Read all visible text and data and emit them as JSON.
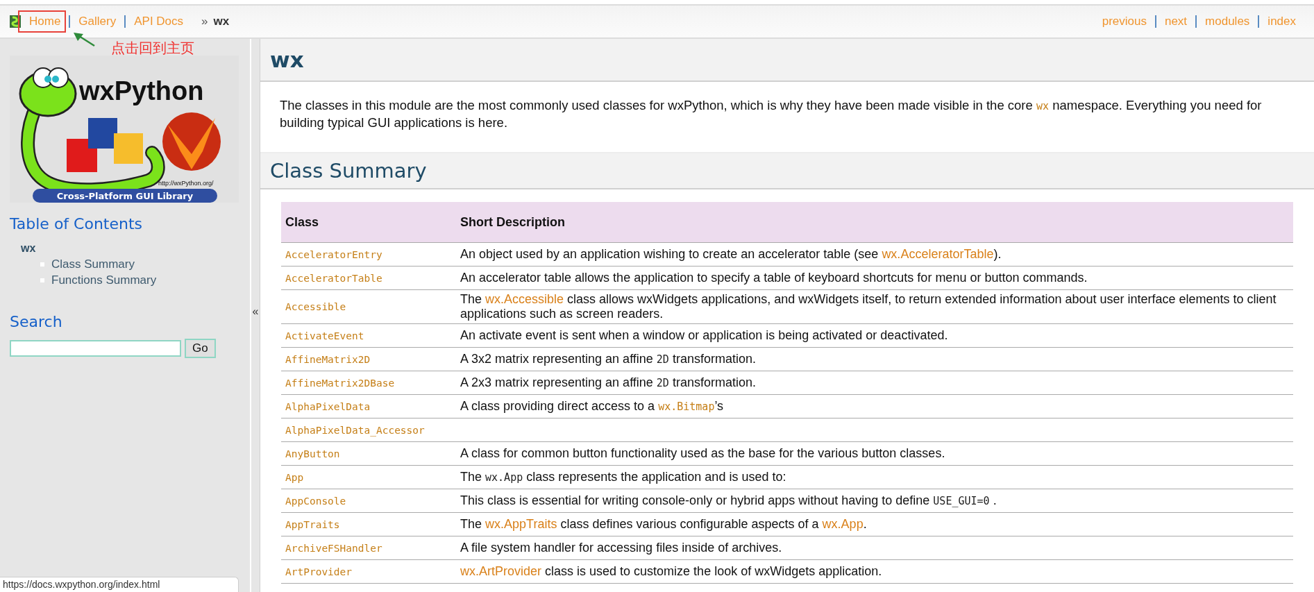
{
  "breadcrumbs": {
    "items": [
      {
        "label": "Home"
      },
      {
        "label": "Gallery"
      },
      {
        "label": "API Docs"
      }
    ],
    "separator": "»",
    "current": "wx"
  },
  "nav": [
    {
      "label": "previous"
    },
    {
      "label": "next"
    },
    {
      "label": "modules"
    },
    {
      "label": "index"
    }
  ],
  "annotation": {
    "text": "点击回到主页"
  },
  "logo": {
    "title": "wxPython",
    "url": "http://wxPython.org/",
    "banner": "Cross-Platform GUI Library"
  },
  "toc": {
    "title": "Table of Contents",
    "root": {
      "label": "wx",
      "children": [
        {
          "label": "Class Summary"
        },
        {
          "label": "Functions Summary"
        }
      ]
    }
  },
  "search": {
    "title": "Search",
    "button": "Go"
  },
  "collapse": "«",
  "page": {
    "title": "wx",
    "intro": [
      {
        "kind": "text",
        "text": "The classes in this module are the most commonly used classes for wxPython, which is why they have been made visible in the core "
      },
      {
        "kind": "code-link",
        "text": "wx"
      },
      {
        "kind": "text",
        "text": " namespace. Everything you need for building typical GUI applications is here."
      }
    ]
  },
  "class_summary": {
    "title": "Class Summary",
    "columns": [
      "Class",
      "Short Description"
    ],
    "rows": [
      {
        "name": "AcceleratorEntry",
        "description": [
          {
            "kind": "text",
            "text": "An object used by an application wishing to create an accelerator table (see "
          },
          {
            "kind": "link",
            "text": "wx.AcceleratorTable"
          },
          {
            "kind": "text",
            "text": ")."
          }
        ]
      },
      {
        "name": "AcceleratorTable",
        "description": [
          {
            "kind": "text",
            "text": "An accelerator table allows the application to specify a table of keyboard shortcuts for menu or button commands."
          }
        ]
      },
      {
        "name": "Accessible",
        "description": [
          {
            "kind": "text",
            "text": "The "
          },
          {
            "kind": "link",
            "text": "wx.Accessible"
          },
          {
            "kind": "text",
            "text": " class allows wxWidgets applications, and wxWidgets itself, to return extended information about user interface elements to client applications such as screen readers."
          }
        ]
      },
      {
        "name": "ActivateEvent",
        "description": [
          {
            "kind": "text",
            "text": "An activate event is sent when a window or application is being activated or deactivated."
          }
        ]
      },
      {
        "name": "AffineMatrix2D",
        "description": [
          {
            "kind": "text",
            "text": "A 3x2 matrix representing an affine "
          },
          {
            "kind": "code",
            "text": "2D"
          },
          {
            "kind": "text",
            "text": " transformation."
          }
        ]
      },
      {
        "name": "AffineMatrix2DBase",
        "description": [
          {
            "kind": "text",
            "text": "A 2x3 matrix representing an affine "
          },
          {
            "kind": "code",
            "text": "2D"
          },
          {
            "kind": "text",
            "text": " transformation."
          }
        ]
      },
      {
        "name": "AlphaPixelData",
        "description": [
          {
            "kind": "text",
            "text": "A class providing direct access to a "
          },
          {
            "kind": "code-link",
            "text": "wx.Bitmap"
          },
          {
            "kind": "text",
            "text": "’s"
          }
        ]
      },
      {
        "name": "AlphaPixelData_Accessor",
        "description": []
      },
      {
        "name": "AnyButton",
        "description": [
          {
            "kind": "text",
            "text": "A class for common button functionality used as the base for the various button classes."
          }
        ]
      },
      {
        "name": "App",
        "description": [
          {
            "kind": "text",
            "text": "The "
          },
          {
            "kind": "code",
            "text": "wx.App"
          },
          {
            "kind": "text",
            "text": " class represents the application and is used to:"
          }
        ]
      },
      {
        "name": "AppConsole",
        "description": [
          {
            "kind": "text",
            "text": "This class is essential for writing console-only or hybrid apps without having to define "
          },
          {
            "kind": "code",
            "text": "USE_GUI=0"
          },
          {
            "kind": "text",
            "text": " ."
          }
        ]
      },
      {
        "name": "AppTraits",
        "description": [
          {
            "kind": "text",
            "text": "The "
          },
          {
            "kind": "link",
            "text": "wx.AppTraits"
          },
          {
            "kind": "text",
            "text": " class defines various configurable aspects of a "
          },
          {
            "kind": "link",
            "text": "wx.App"
          },
          {
            "kind": "text",
            "text": "."
          }
        ]
      },
      {
        "name": "ArchiveFSHandler",
        "description": [
          {
            "kind": "text",
            "text": "A file system handler for accessing files inside of archives."
          }
        ]
      },
      {
        "name": "ArtProvider",
        "description": [
          {
            "kind": "link",
            "text": "wx.ArtProvider"
          },
          {
            "kind": "text",
            "text": " class is used to customize the look of wxWidgets application."
          }
        ]
      }
    ]
  },
  "status_bar": {
    "url": "https://docs.wxpython.org/index.html"
  }
}
